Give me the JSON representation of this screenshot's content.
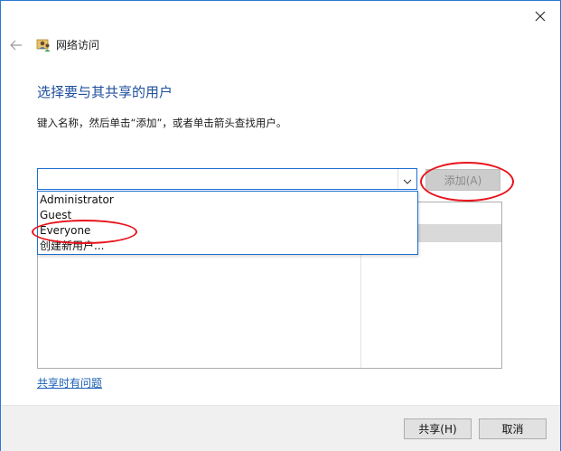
{
  "window": {
    "title": "网络访问",
    "close_icon": "close-icon",
    "back_icon": "back-arrow-icon",
    "header_icon": "network-users-icon"
  },
  "main": {
    "heading": "选择要与其共享的用户",
    "instruction": "键入名称，然后单击“添加”，或者单击箭头查找用户。",
    "user_input_value": "",
    "add_button_label": "添加(A)"
  },
  "dropdown": {
    "items": [
      {
        "label": "Administrator"
      },
      {
        "label": "Guest"
      },
      {
        "label": "Everyone"
      },
      {
        "label": "创建新用户..."
      }
    ]
  },
  "help_link": "共享时有问题",
  "footer": {
    "share_button_label": "共享(H)",
    "cancel_button_label": "取消"
  },
  "colors": {
    "accent": "#1f6fd1",
    "heading": "#1e4e9c",
    "annotation_red": "#e8141c"
  }
}
